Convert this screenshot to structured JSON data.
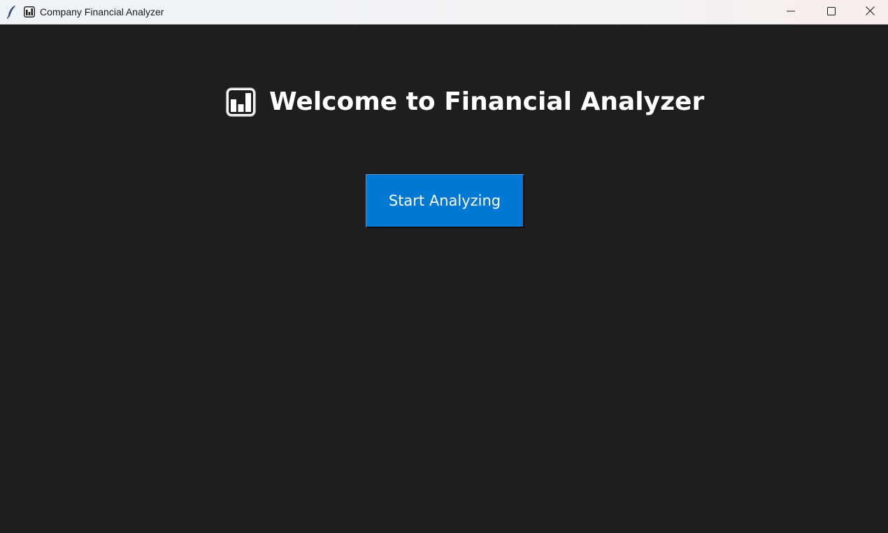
{
  "window": {
    "title": "Company Financial Analyzer",
    "app_icon": "feather-icon",
    "title_icon": "bar-chart-icon",
    "controls": [
      "minimize-icon",
      "maximize-icon",
      "close-icon"
    ]
  },
  "main": {
    "heading_icon": "bar-chart-icon",
    "heading": "Welcome to Financial Analyzer",
    "start_button_label": "Start Analyzing"
  },
  "colors": {
    "background": "#1e1e1e",
    "accent": "#0078d4",
    "heading_text": "#ffffff",
    "titlebar": "#f2f3f5"
  }
}
